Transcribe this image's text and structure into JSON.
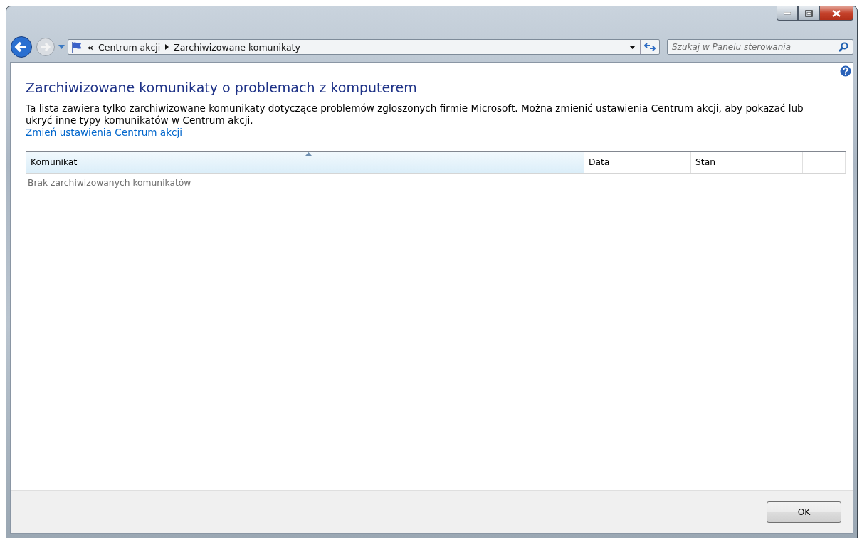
{
  "address_bar": {
    "overflow": "«",
    "breadcrumbs": [
      "Centrum akcji",
      "Zarchiwizowane komunikaty"
    ]
  },
  "search": {
    "placeholder": "Szukaj w Panelu sterowania"
  },
  "heading": "Zarchiwizowane komunikaty o problemach z komputerem",
  "description": "Ta lista zawiera tylko zarchiwizowane komunikaty dotyczące problemów zgłoszonych firmie Microsoft. Można zmienić ustawienia Centrum akcji, aby pokazać lub ukryć inne typy komunikatów w Centrum akcji.",
  "link": "Zmień ustawienia Centrum akcji",
  "table": {
    "columns": [
      {
        "label": "Komunikat",
        "sorted": true
      },
      {
        "label": "Data",
        "sorted": false
      },
      {
        "label": "Stan",
        "sorted": false
      }
    ],
    "empty_text": "Brak zarchiwizowanych komunikatów"
  },
  "buttons": [
    "OK"
  ]
}
